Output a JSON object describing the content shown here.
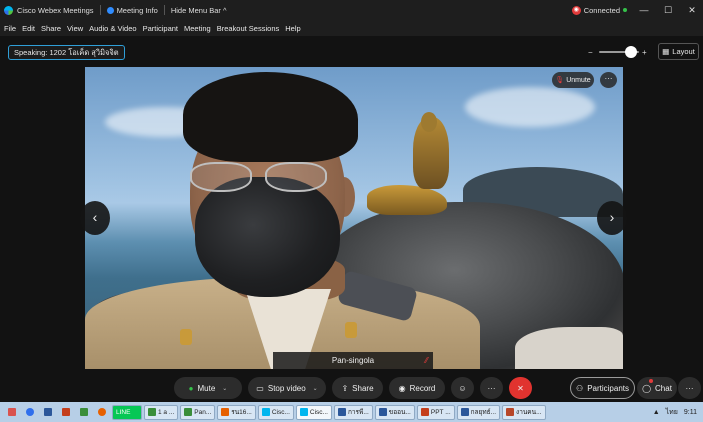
{
  "titlebar": {
    "app_title": "Cisco Webex Meetings",
    "meeting_info": "Meeting Info",
    "hide_menu_bar": "Hide Menu Bar ^",
    "connection_status": "Connected",
    "minimize": "—",
    "maximize": "☐",
    "close": "✕"
  },
  "menu": [
    "File",
    "Edit",
    "Share",
    "View",
    "Audio & Video",
    "Participant",
    "Meeting",
    "Breakout Sessions",
    "Help"
  ],
  "speaking": "Speaking: 1202 โอเค็ด สุวิมิจจิต",
  "zoom": {
    "level": 0.8,
    "out_icon": "−",
    "in_icon": "+"
  },
  "layout_label": "Layout",
  "video": {
    "unmute_label": "Unmute",
    "participant_name": "Pan-singola",
    "more_icon": "···",
    "prev_icon": "‹",
    "next_icon": "›"
  },
  "controls": {
    "mute": "Mute",
    "stop_video": "Stop video",
    "share": "Share",
    "record": "Record",
    "reactions_icon": "☺",
    "more_icon": "···",
    "end_icon": "✕",
    "participants": "Participants",
    "chat": "Chat",
    "panel_more_icon": "···"
  },
  "taskbar": {
    "items": [
      "LINE",
      "1 a ...",
      "Pan...",
      "รน16...",
      "Cisc...",
      "Cisc...",
      "การพี...",
      "ขออน...",
      "PPT ...",
      "กลยุทธ์...",
      "งานคน..."
    ],
    "language": "ไทย",
    "time": "9:11"
  },
  "colors": {
    "accent": "#2f9fd8",
    "end_call": "#e1332f",
    "connected": "#35c14a"
  }
}
